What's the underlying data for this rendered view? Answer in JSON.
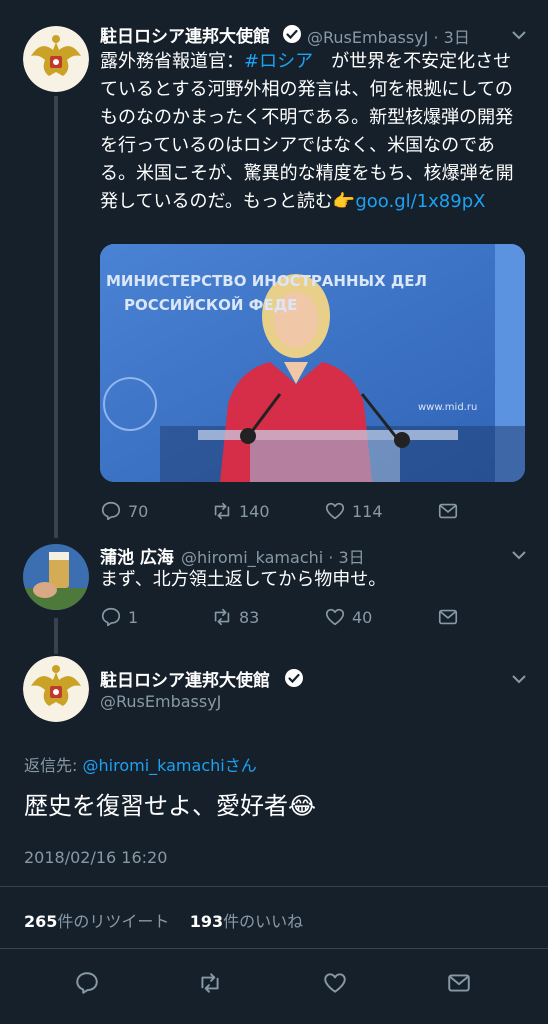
{
  "tweet1": {
    "name": "駐日ロシア連邦大使館",
    "handle": "@RusEmbassyJ · 3日",
    "text_a": "露外務省報道官：",
    "hashtag": "#ロシア",
    "text_b": "　が世界を不安定化させているとする河野外相の発言は、何を根拠にしてのものなのかまったく不明である。新型核爆弾の開発を行っているのはロシアではなく、米国なのである。米国こそが、驚異的な精度をもち、核爆弾を開発しているのだ。もっと読む",
    "emoji": "👉",
    "url": "goo.gl/1x89pX",
    "image_banner_lines": [
      "МИНИСТЕРСТВО ИНОСТРАННЫХ ДЕЛ",
      "РОССИЙСКОЙ ФЕДЕ"
    ],
    "image_site": "www.mid.ru",
    "replies": "70",
    "retweets": "140",
    "likes": "114"
  },
  "tweet2": {
    "name": "蒲池 広海",
    "handle": "@hiromi_kamachi · 3日",
    "text": "まず、北方領土返してから物申せ。",
    "replies": "1",
    "retweets": "83",
    "likes": "40"
  },
  "main": {
    "name": "駐日ロシア連邦大使館",
    "handle": "@RusEmbassyJ",
    "reply_to_label": "返信先:",
    "reply_to_user": "@hiromi_kamachi",
    "reply_to_suffix": "さん",
    "text": "歴史を復習せよ、愛好者",
    "emoji": "😂",
    "timestamp": "2018/02/16 16:20",
    "retweet_count": "265",
    "retweet_label": "件のリツイート",
    "like_count": "193",
    "like_label": "件のいいね"
  },
  "colors": {
    "background": "#15202b",
    "muted": "#8899a6",
    "link": "#1da1f2",
    "divider": "#38444d"
  }
}
